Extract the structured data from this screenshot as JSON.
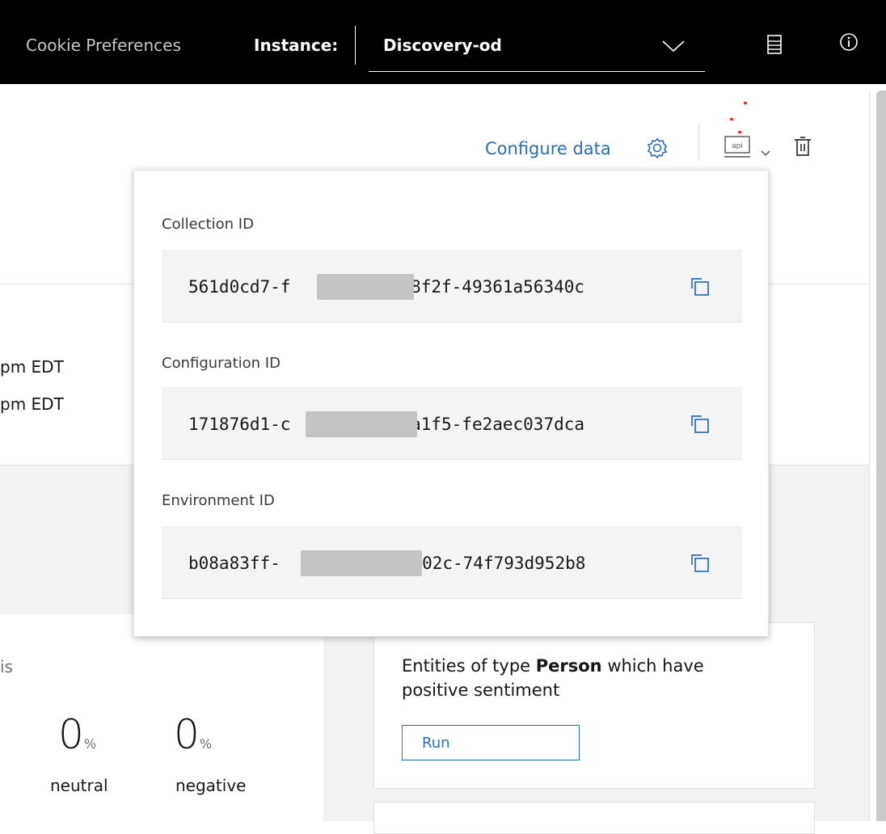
{
  "header": {
    "cookie_link": "Cookie Preferences",
    "instance_label": "Instance:",
    "instance_value": "Discovery-od"
  },
  "toolbar": {
    "configure_label": "Configure data"
  },
  "background": {
    "time_line_1": "pm EDT",
    "time_line_2": "pm EDT",
    "partial_heading": "is",
    "stat_neutral_value": "0",
    "stat_neutral_unit": "%",
    "stat_neutral_label": "neutral",
    "stat_negative_value": "0",
    "stat_negative_unit": "%",
    "stat_negative_label": "negative"
  },
  "query_card": {
    "text_before": "Entities of type ",
    "text_bold": "Person",
    "text_after": " which have positive sentiment",
    "run_label": "Run"
  },
  "popover": {
    "collection": {
      "label": "Collection ID",
      "prefix": "561d0cd7-f",
      "suffix": "-8f2f-49361a56340c"
    },
    "configuration": {
      "label": "Configuration ID",
      "prefix": "171876d1-c",
      "suffix": "-a1f5-fe2aec037dca"
    },
    "environment": {
      "label": "Environment ID",
      "prefix": "b08a83ff-",
      "suffix": "-a02c-74f793d952b8"
    }
  },
  "icons": {
    "chevron": "chevron-down-icon",
    "doc": "document-icon",
    "info": "info-icon",
    "gear": "gear-icon",
    "api": "api-icon",
    "trash": "trash-icon",
    "copy": "copy-icon"
  },
  "colors": {
    "topbar": "#000000",
    "link": "#2e6db4",
    "field_bg": "#f4f4f4",
    "band": "#f2f2f2"
  }
}
